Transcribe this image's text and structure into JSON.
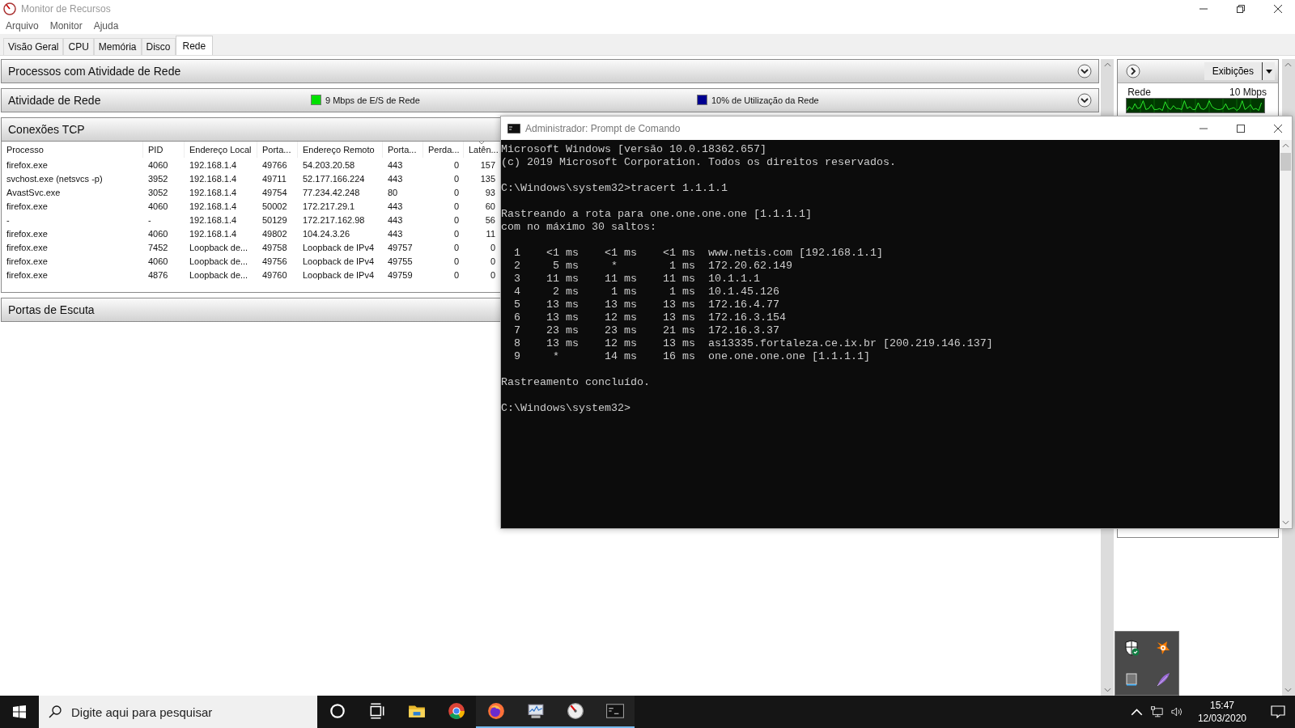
{
  "window": {
    "title": "Monitor de Recursos"
  },
  "menu": [
    "Arquivo",
    "Monitor",
    "Ajuda"
  ],
  "tabs": [
    {
      "label": "Visão Geral",
      "selected": false
    },
    {
      "label": "CPU",
      "selected": false
    },
    {
      "label": "Memória",
      "selected": false
    },
    {
      "label": "Disco",
      "selected": false
    },
    {
      "label": "Rede",
      "selected": true
    }
  ],
  "panels": [
    {
      "title": "Processos com Atividade de Rede",
      "expanded": false
    },
    {
      "title": "Atividade de Rede",
      "expanded": false,
      "legend": [
        {
          "label": "9 Mbps de E/S de Rede",
          "color": "#00e000"
        },
        {
          "label": "10% de Utilização da Rede",
          "color": "#000090"
        }
      ]
    },
    {
      "title": "Conexões TCP",
      "expanded": true,
      "table": {
        "columns": [
          {
            "label": "Processo",
            "sorted": false
          },
          {
            "label": "PID",
            "sorted": false
          },
          {
            "label": "Endereço Local",
            "sorted": false
          },
          {
            "label": "Porta...",
            "sorted": false
          },
          {
            "label": "Endereço Remoto",
            "sorted": false
          },
          {
            "label": "Porta...",
            "sorted": false
          },
          {
            "label": "Perda...",
            "sorted": false
          },
          {
            "label": "Latên...",
            "sorted": true
          }
        ],
        "rows": [
          [
            "firefox.exe",
            "4060",
            "192.168.1.4",
            "49766",
            "54.203.20.58",
            "443",
            "0",
            "157"
          ],
          [
            "svchost.exe (netsvcs -p)",
            "3952",
            "192.168.1.4",
            "49711",
            "52.177.166.224",
            "443",
            "0",
            "135"
          ],
          [
            "AvastSvc.exe",
            "3052",
            "192.168.1.4",
            "49754",
            "77.234.42.248",
            "80",
            "0",
            "93"
          ],
          [
            "firefox.exe",
            "4060",
            "192.168.1.4",
            "50002",
            "172.217.29.1",
            "443",
            "0",
            "60"
          ],
          [
            "-",
            "-",
            "192.168.1.4",
            "50129",
            "172.217.162.98",
            "443",
            "0",
            "56"
          ],
          [
            "firefox.exe",
            "4060",
            "192.168.1.4",
            "49802",
            "104.24.3.26",
            "443",
            "0",
            "11"
          ],
          [
            "firefox.exe",
            "7452",
            "Loopback de...",
            "49758",
            "Loopback de IPv4",
            "49757",
            "0",
            "0"
          ],
          [
            "firefox.exe",
            "4060",
            "Loopback de...",
            "49756",
            "Loopback de IPv4",
            "49755",
            "0",
            "0"
          ],
          [
            "firefox.exe",
            "4876",
            "Loopback de...",
            "49760",
            "Loopback de IPv4",
            "49759",
            "0",
            "0"
          ]
        ]
      }
    },
    {
      "title": "Portas de Escuta"
    }
  ],
  "side_panel": {
    "views_button": "Exibições",
    "graph": {
      "title": "Rede",
      "scale": "10 Mbps"
    }
  },
  "console": {
    "title": "Administrador: Prompt de Comando",
    "blocks": [
      [
        "Microsoft Windows [versão 10.0.18362.657]",
        "(c) 2019 Microsoft Corporation. Todos os direitos reservados."
      ],
      [
        "C:\\Windows\\system32>tracert 1.1.1.1"
      ],
      [
        "Rastreando a rota para one.one.one.one [1.1.1.1]",
        "com no máximo 30 saltos:"
      ],
      [
        "  1    <1 ms    <1 ms    <1 ms  www.netis.com [192.168.1.1]",
        "  2     5 ms     *        1 ms  172.20.62.149",
        "  3    11 ms    11 ms    11 ms  10.1.1.1",
        "  4     2 ms     1 ms     1 ms  10.1.45.126",
        "  5    13 ms    13 ms    13 ms  172.16.4.77",
        "  6    13 ms    12 ms    13 ms  172.16.3.154",
        "  7    23 ms    23 ms    21 ms  172.16.3.37",
        "  8    13 ms    12 ms    13 ms  as13335.fortaleza.ce.ix.br [200.219.146.137]",
        "  9     *       14 ms    16 ms  one.one.one.one [1.1.1.1]"
      ],
      [
        "Rastreamento concluído."
      ],
      [
        "C:\\Windows\\system32>"
      ]
    ]
  },
  "taskbar": {
    "search": {
      "placeholder": "Digite aqui para pesquisar"
    },
    "apps": [
      {
        "kind": "cortana",
        "running": false
      },
      {
        "kind": "taskview",
        "running": false
      },
      {
        "kind": "folder",
        "running": false
      },
      {
        "kind": "chrome",
        "running": false
      },
      {
        "kind": "firefox",
        "running": true
      },
      {
        "kind": "resmon",
        "running": true
      },
      {
        "kind": "gauge",
        "running": true
      },
      {
        "kind": "terminal",
        "running": true
      }
    ],
    "clock": {
      "time": "15:47",
      "date": "12/03/2020"
    }
  },
  "tray_popup": {
    "icons": [
      {
        "kind": "shield"
      },
      {
        "kind": "splash"
      },
      {
        "kind": "device"
      },
      {
        "kind": "feather"
      }
    ]
  }
}
